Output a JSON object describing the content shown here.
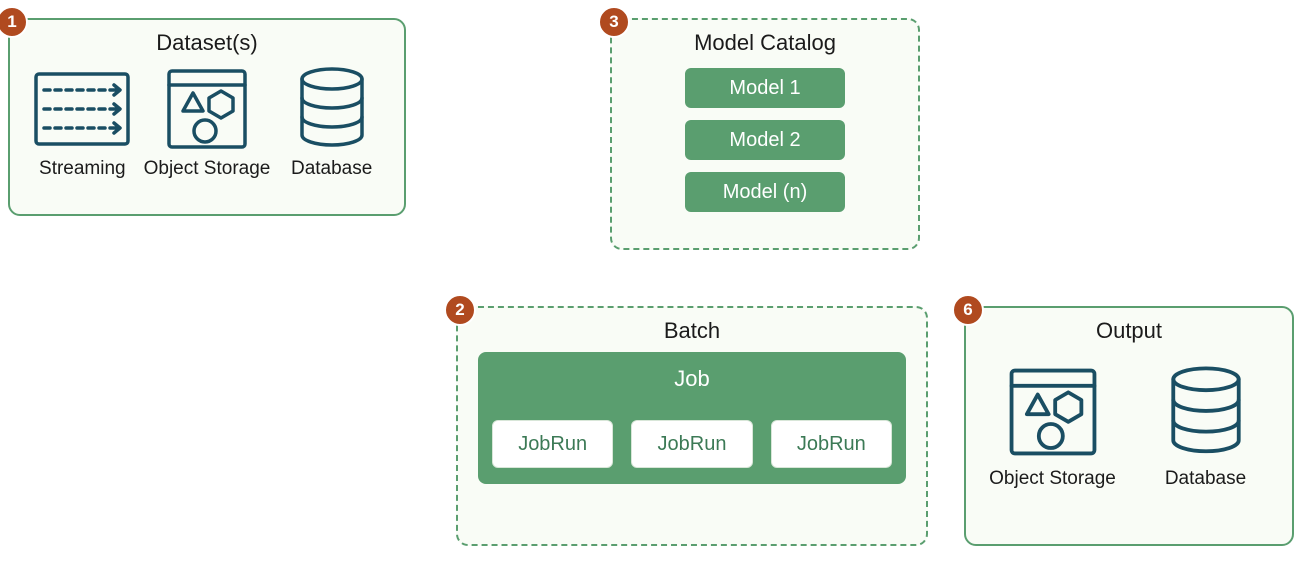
{
  "datasets": {
    "badge": "1",
    "title": "Dataset(s)",
    "items": [
      {
        "label": "Streaming"
      },
      {
        "label": "Object Storage"
      },
      {
        "label": "Database"
      }
    ]
  },
  "model_catalog": {
    "badge": "3",
    "title": "Model Catalog",
    "models": [
      {
        "label": "Model 1"
      },
      {
        "label": "Model 2"
      },
      {
        "label": "Model (n)"
      }
    ]
  },
  "batch": {
    "badge": "2",
    "title": "Batch",
    "job_label": "Job",
    "jobruns": [
      {
        "label": "JobRun"
      },
      {
        "label": "JobRun"
      },
      {
        "label": "JobRun"
      }
    ]
  },
  "output": {
    "badge": "6",
    "title": "Output",
    "items": [
      {
        "label": "Object Storage"
      },
      {
        "label": "Database"
      }
    ]
  }
}
